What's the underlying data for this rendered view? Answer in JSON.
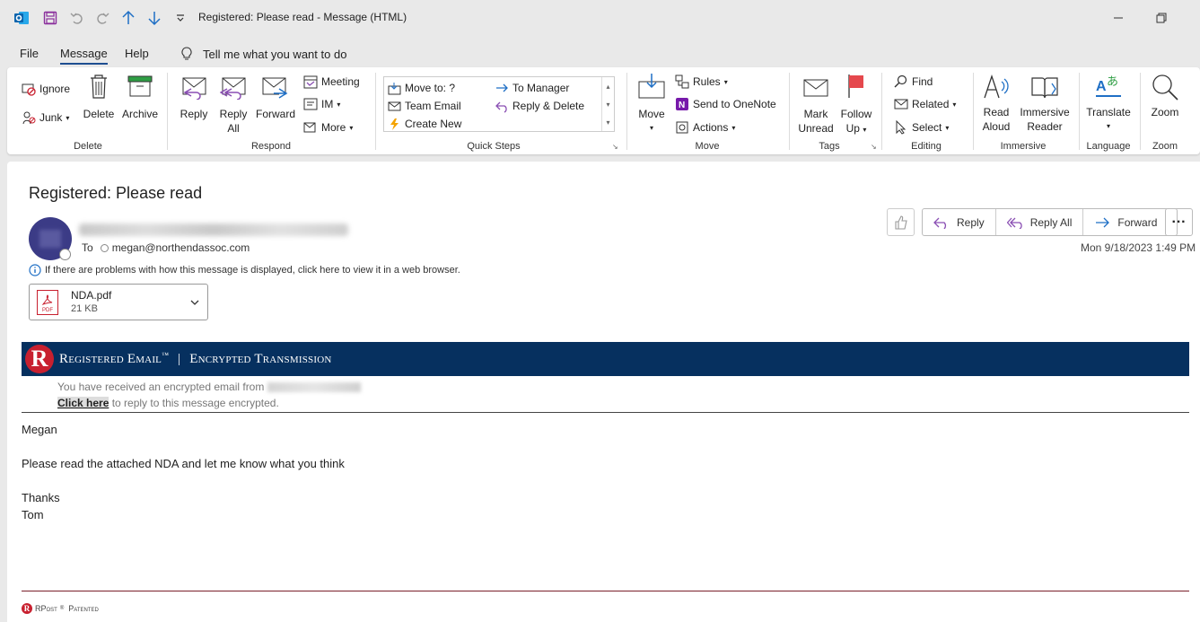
{
  "window": {
    "title": "Registered: Please read  -  Message (HTML)"
  },
  "menu": {
    "file": "File",
    "message": "Message",
    "help": "Help",
    "tell_me": "Tell me what you want to do"
  },
  "ribbon": {
    "delete_group": {
      "label": "Delete",
      "ignore": "Ignore",
      "junk": "Junk",
      "delete": "Delete",
      "archive": "Archive"
    },
    "respond_group": {
      "label": "Respond",
      "reply": "Reply",
      "reply_all_1": "Reply",
      "reply_all_2": "All",
      "forward": "Forward",
      "meeting": "Meeting",
      "im": "IM",
      "more": "More"
    },
    "quick_steps": {
      "label": "Quick Steps",
      "move_to": "Move to: ?",
      "team_email": "Team Email",
      "create_new": "Create New",
      "to_manager": "To Manager",
      "reply_delete": "Reply & Delete"
    },
    "move_group": {
      "label": "Move",
      "move": "Move",
      "rules": "Rules",
      "onenote": "Send to OneNote",
      "actions": "Actions"
    },
    "tags_group": {
      "label": "Tags",
      "mark_unread_1": "Mark",
      "mark_unread_2": "Unread",
      "follow_up_1": "Follow",
      "follow_up_2": "Up"
    },
    "editing_group": {
      "label": "Editing",
      "find": "Find",
      "related": "Related",
      "select": "Select"
    },
    "immersive_group": {
      "label": "Immersive",
      "read_aloud_1": "Read",
      "read_aloud_2": "Aloud",
      "reader_1": "Immersive",
      "reader_2": "Reader"
    },
    "language_group": {
      "label": "Language",
      "translate": "Translate"
    },
    "zoom_group": {
      "label": "Zoom",
      "zoom": "Zoom"
    }
  },
  "message": {
    "subject": "Registered: Please read",
    "to_label": "To",
    "recipient": "megan@northendassoc.com",
    "date": "Mon 9/18/2023 1:49 PM",
    "info_bar": "If there are problems with how this message is displayed, click here to view it in a web browser.",
    "actions": {
      "reply": "Reply",
      "reply_all": "Reply All",
      "forward": "Forward"
    },
    "attachment": {
      "name": "NDA.pdf",
      "size": "21 KB",
      "icon_label": "PDF"
    },
    "banner": {
      "logo_letter": "R",
      "brand": "Registered Email",
      "tm": "™",
      "divider": "|",
      "subtitle": "Encrypted Transmission"
    },
    "notice": {
      "line1": "You have received an encrypted email from",
      "link": "Click here",
      "line2_rest": " to reply to this message encrypted."
    },
    "body": {
      "greeting": "Megan",
      "paragraph": "Please read the attached NDA and let me know what you think",
      "closing": "Thanks",
      "signature": "Tom"
    },
    "footer": {
      "brand": "RPost",
      "reg": "®",
      "patented": "Patented"
    }
  },
  "colors": {
    "accent": "#1e4e91",
    "banner": "#06305f",
    "rpost_red": "#c8202f",
    "reply_purple": "#8a4fb3",
    "forward_blue": "#1f6fc5"
  }
}
